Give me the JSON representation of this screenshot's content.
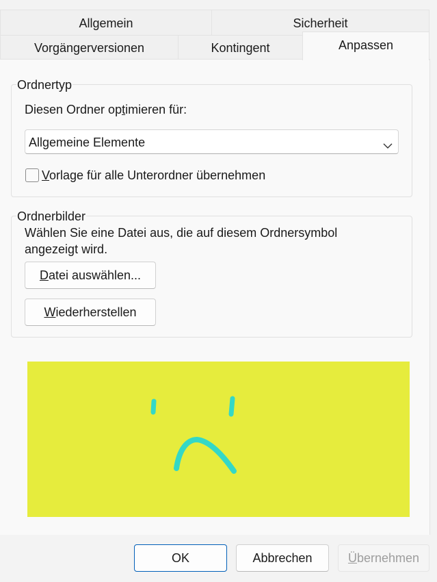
{
  "tabs_row1": [
    {
      "label": "Allgemein"
    },
    {
      "label": "Sicherheit"
    }
  ],
  "tabs_row2": [
    {
      "label": "Vorgängerversionen"
    },
    {
      "label": "Kontingent"
    },
    {
      "label": "Anpassen"
    }
  ],
  "active_tab": "Anpassen",
  "folder_type": {
    "group_title": "Ordnertyp",
    "optimize_label_pre": "Diesen Ordner op",
    "optimize_label_mnemonic": "t",
    "optimize_label_post": "imieren für:",
    "select_value": "Allgemeine Elemente",
    "checkbox_mnemonic": "V",
    "checkbox_label_rest": "orlage für alle Unterordner übernehmen",
    "checkbox_checked": false
  },
  "folder_pictures": {
    "group_title": "Ordnerbilder",
    "description_line1": "Wählen Sie eine Datei aus, die auf diesem Ordnersymbol",
    "description_line2": "angezeigt wird.",
    "choose_mnemonic": "D",
    "choose_rest": "atei auswählen...",
    "restore_mnemonic": "W",
    "restore_rest": "iederherstellen"
  },
  "preview": {
    "background_color": "#e6ec3d",
    "stroke_color": "#34d8c6"
  },
  "footer": {
    "ok_label": "OK",
    "cancel_label": "Abbrechen",
    "apply_mnemonic": "Ü",
    "apply_rest": "bernehmen"
  }
}
